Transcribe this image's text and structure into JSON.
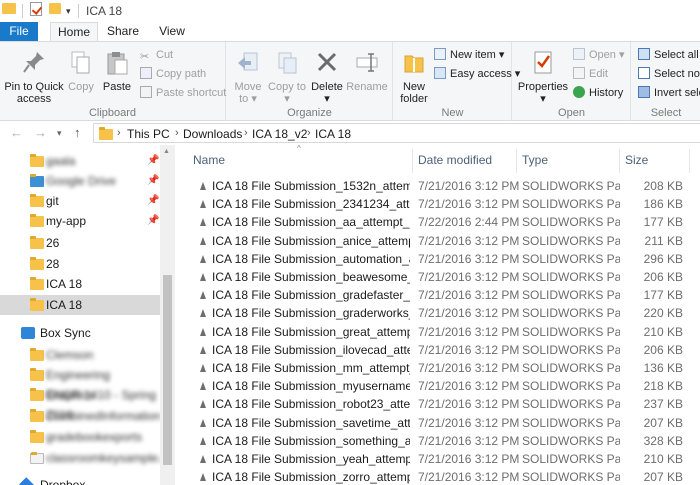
{
  "window": {
    "title": "ICA 18"
  },
  "tabs": {
    "file": "File",
    "home": "Home",
    "share": "Share",
    "view": "View"
  },
  "ribbon": {
    "clipboard": {
      "label": "Clipboard",
      "pin": "Pin to Quick access",
      "copy": "Copy",
      "paste": "Paste",
      "cut": "Cut",
      "copy_path": "Copy path",
      "paste_shortcut": "Paste shortcut"
    },
    "organize": {
      "label": "Organize",
      "move_to": "Move to",
      "copy_to": "Copy to",
      "delete": "Delete",
      "rename": "Rename"
    },
    "new": {
      "label": "New",
      "new_folder": "New folder",
      "new_item": "New item",
      "easy_access": "Easy access"
    },
    "open": {
      "label": "Open",
      "properties": "Properties",
      "open": "Open",
      "edit": "Edit",
      "history": "History"
    },
    "select": {
      "label": "Select",
      "select_all": "Select all",
      "select_none": "Select none",
      "invert": "Invert selection"
    }
  },
  "address": {
    "crumbs": [
      "This PC",
      "Downloads",
      "ICA 18_v2",
      "ICA 18"
    ]
  },
  "nav": {
    "items": [
      {
        "label": "gaala",
        "blurred": true,
        "pinned": true
      },
      {
        "label": "Google Drive",
        "blurred": true,
        "pinned": true
      },
      {
        "label": "git",
        "blurred": false,
        "pinned": true
      },
      {
        "label": "my-app",
        "blurred": false,
        "pinned": true
      },
      {
        "label": "26",
        "blurred": false,
        "pinned": false
      },
      {
        "label": "28",
        "blurred": false,
        "pinned": false
      },
      {
        "label": "ICA 18",
        "blurred": false,
        "pinned": false
      },
      {
        "label": "ICA 18",
        "blurred": false,
        "pinned": false
      }
    ],
    "box_sync": "Box Sync",
    "box_items": [
      "Clemson",
      "Engineering Graphics",
      "ENGR 1410 - Spring 2016",
      "CombinedInformation",
      "gradebookexports",
      "classroomkeysample.xlsx"
    ],
    "dropbox": "Dropbox"
  },
  "columns": {
    "name": "Name",
    "date": "Date modified",
    "type": "Type",
    "size": "Size"
  },
  "files": [
    {
      "name": "ICA 18 File Submission_1532n_attempt_2...",
      "date": "7/21/2016 3:12 PM",
      "type": "SOLIDWORKS Part...",
      "size": "208 KB"
    },
    {
      "name": "ICA 18 File Submission_2341234_attempt...",
      "date": "7/21/2016 3:12 PM",
      "type": "SOLIDWORKS Part...",
      "size": "186 KB"
    },
    {
      "name": "ICA 18 File Submission_aa_attempt_2016...",
      "date": "7/22/2016 2:44 PM",
      "type": "SOLIDWORKS Part...",
      "size": "177 KB"
    },
    {
      "name": "ICA 18 File Submission_anice_attempt_2...",
      "date": "7/21/2016 3:12 PM",
      "type": "SOLIDWORKS Part...",
      "size": "211 KB"
    },
    {
      "name": "ICA 18 File Submission_automation_atte...",
      "date": "7/21/2016 3:12 PM",
      "type": "SOLIDWORKS Part...",
      "size": "296 KB"
    },
    {
      "name": "ICA 18 File Submission_beawesome_attem...",
      "date": "7/21/2016 3:12 PM",
      "type": "SOLIDWORKS Part...",
      "size": "206 KB"
    },
    {
      "name": "ICA 18 File Submission_gradefaster_atte...",
      "date": "7/21/2016 3:12 PM",
      "type": "SOLIDWORKS Part...",
      "size": "177 KB"
    },
    {
      "name": "ICA 18 File Submission_graderworks_atte...",
      "date": "7/21/2016 3:12 PM",
      "type": "SOLIDWORKS Part...",
      "size": "220 KB"
    },
    {
      "name": "ICA 18 File Submission_great_attempt_2...",
      "date": "7/21/2016 3:12 PM",
      "type": "SOLIDWORKS Part...",
      "size": "210 KB"
    },
    {
      "name": "ICA 18 File Submission_ilovecad_attemp...",
      "date": "7/21/2016 3:12 PM",
      "type": "SOLIDWORKS Part...",
      "size": "206 KB"
    },
    {
      "name": "ICA 18 File Submission_mm_attempt_20...",
      "date": "7/21/2016 3:12 PM",
      "type": "SOLIDWORKS Part...",
      "size": "136 KB"
    },
    {
      "name": "ICA 18 File Submission_myusernameexa...",
      "date": "7/21/2016 3:12 PM",
      "type": "SOLIDWORKS Part...",
      "size": "218 KB"
    },
    {
      "name": "ICA 18 File Submission_robot23_attempt...",
      "date": "7/21/2016 3:12 PM",
      "type": "SOLIDWORKS Part...",
      "size": "237 KB"
    },
    {
      "name": "ICA 18 File Submission_savetime_attemp...",
      "date": "7/21/2016 3:12 PM",
      "type": "SOLIDWORKS Part...",
      "size": "207 KB"
    },
    {
      "name": "ICA 18 File Submission_something_atte...",
      "date": "7/21/2016 3:12 PM",
      "type": "SOLIDWORKS Part...",
      "size": "328 KB"
    },
    {
      "name": "ICA 18 File Submission_yeah_attempt_20...",
      "date": "7/21/2016 3:12 PM",
      "type": "SOLIDWORKS Part...",
      "size": "210 KB"
    },
    {
      "name": "ICA 18 File Submission_zorro_attempt_2...",
      "date": "7/21/2016 3:12 PM",
      "type": "SOLIDWORKS Part...",
      "size": "207 KB"
    }
  ]
}
